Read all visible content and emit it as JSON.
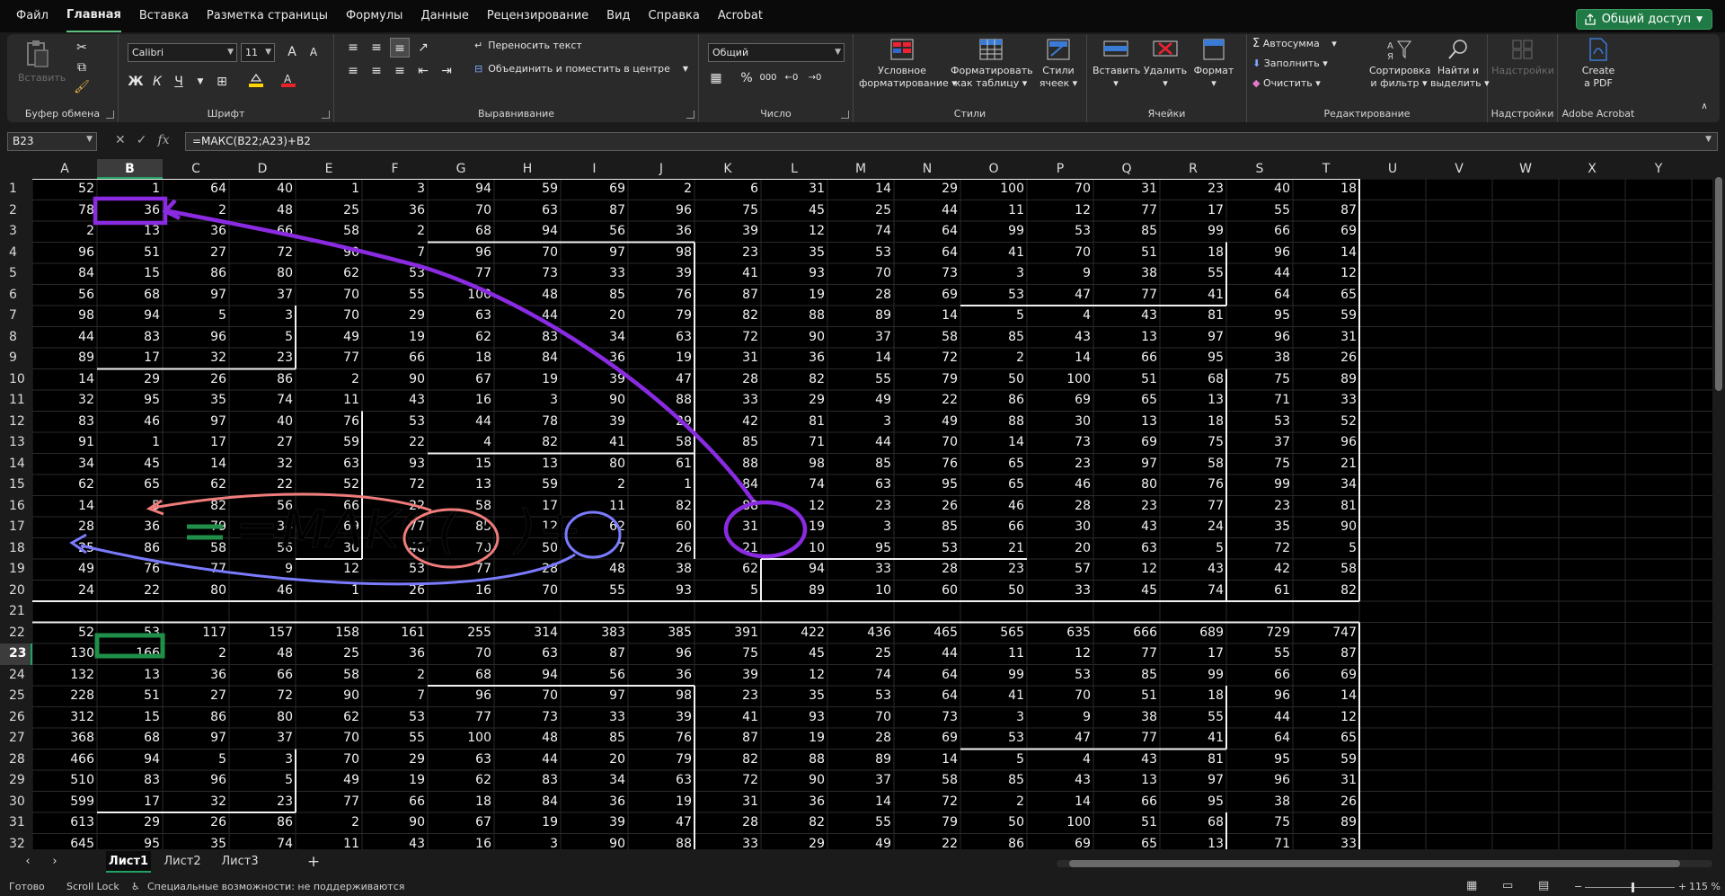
{
  "menu": {
    "items": [
      "Файл",
      "Главная",
      "Вставка",
      "Разметка страницы",
      "Формулы",
      "Данные",
      "Рецензирование",
      "Вид",
      "Справка",
      "Acrobat"
    ],
    "share": "Общий доступ"
  },
  "ribbon": {
    "clipboard": {
      "paste": "Вставить",
      "label": "Буфер обмена"
    },
    "font": {
      "name": "Calibri",
      "size": "11",
      "label": "Шрифт",
      "bold": "Ж",
      "italic": "К",
      "underline": "Ч"
    },
    "alignment": {
      "wrap": "Переносить текст",
      "merge": "Объединить и поместить в центре",
      "label": "Выравнивание"
    },
    "number": {
      "format": "Общий",
      "label": "Число",
      "percent": "%",
      "thousands": "000"
    },
    "styles": {
      "conditional": [
        "Условное",
        "форматирование"
      ],
      "table": [
        "Форматировать",
        "как таблицу"
      ],
      "cell": [
        "Стили",
        "ячеек"
      ],
      "label": "Стили"
    },
    "cells": {
      "insert": "Вставить",
      "delete": "Удалить",
      "format": "Формат",
      "label": "Ячейки"
    },
    "editing": {
      "autosum": "Автосумма",
      "fill": "Заполнить",
      "clear": "Очистить",
      "sort": [
        "Сортировка",
        "и фильтр"
      ],
      "find": [
        "Найти и",
        "выделить"
      ],
      "label": "Редактирование"
    },
    "addins": {
      "button": "Надстройки",
      "label": "Надстройки"
    },
    "acrobat": {
      "create": [
        "Create",
        "a PDF"
      ],
      "label": "Adobe Acrobat"
    }
  },
  "formula_bar": {
    "name_box": "B23",
    "fx": "fx",
    "formula": "=МАКС(B22;A23)+B2"
  },
  "columns": [
    "A",
    "B",
    "C",
    "D",
    "E",
    "F",
    "G",
    "H",
    "I",
    "J",
    "K",
    "L",
    "M",
    "N",
    "O",
    "P",
    "Q",
    "R",
    "S",
    "T",
    "U",
    "V",
    "W",
    "X",
    "Y"
  ],
  "rows": {
    "1": [
      52,
      1,
      64,
      40,
      1,
      3,
      94,
      59,
      69,
      2,
      6,
      31,
      14,
      29,
      100,
      70,
      31,
      23,
      40,
      18
    ],
    "2": [
      78,
      36,
      2,
      48,
      25,
      36,
      70,
      63,
      87,
      96,
      75,
      45,
      25,
      44,
      11,
      12,
      77,
      17,
      55,
      87
    ],
    "3": [
      2,
      13,
      36,
      66,
      58,
      2,
      68,
      94,
      56,
      36,
      39,
      12,
      74,
      64,
      99,
      53,
      85,
      99,
      66,
      69
    ],
    "4": [
      96,
      51,
      27,
      72,
      90,
      7,
      96,
      70,
      97,
      98,
      23,
      35,
      53,
      64,
      41,
      70,
      51,
      18,
      96,
      14
    ],
    "5": [
      84,
      15,
      86,
      80,
      62,
      53,
      77,
      73,
      33,
      39,
      41,
      93,
      70,
      73,
      3,
      9,
      38,
      55,
      44,
      12
    ],
    "6": [
      56,
      68,
      97,
      37,
      70,
      55,
      100,
      48,
      85,
      76,
      87,
      19,
      28,
      69,
      53,
      47,
      77,
      41,
      64,
      65
    ],
    "7": [
      98,
      94,
      5,
      3,
      70,
      29,
      63,
      44,
      20,
      79,
      82,
      88,
      89,
      14,
      5,
      4,
      43,
      81,
      95,
      59
    ],
    "8": [
      44,
      83,
      96,
      5,
      49,
      19,
      62,
      83,
      34,
      63,
      72,
      90,
      37,
      58,
      85,
      43,
      13,
      97,
      96,
      31
    ],
    "9": [
      89,
      17,
      32,
      23,
      77,
      66,
      18,
      84,
      36,
      19,
      31,
      36,
      14,
      72,
      2,
      14,
      66,
      95,
      38,
      26
    ],
    "10": [
      14,
      29,
      26,
      86,
      2,
      90,
      67,
      19,
      39,
      47,
      28,
      82,
      55,
      79,
      50,
      100,
      51,
      68,
      75,
      89
    ],
    "11": [
      32,
      95,
      35,
      74,
      11,
      43,
      16,
      3,
      90,
      88,
      33,
      29,
      49,
      22,
      86,
      69,
      65,
      13,
      71,
      33
    ],
    "12": [
      83,
      46,
      97,
      40,
      76,
      53,
      44,
      78,
      39,
      29,
      42,
      81,
      3,
      49,
      88,
      30,
      13,
      18,
      53,
      52
    ],
    "13": [
      91,
      1,
      17,
      27,
      59,
      22,
      4,
      82,
      41,
      58,
      85,
      71,
      44,
      70,
      14,
      73,
      69,
      75,
      37,
      96
    ],
    "14": [
      34,
      45,
      14,
      32,
      63,
      93,
      15,
      13,
      80,
      61,
      88,
      98,
      85,
      76,
      65,
      23,
      97,
      58,
      75,
      21
    ],
    "15": [
      62,
      65,
      62,
      22,
      52,
      72,
      13,
      59,
      2,
      1,
      84,
      74,
      63,
      95,
      65,
      46,
      80,
      76,
      99,
      34
    ],
    "16": [
      14,
      5,
      82,
      56,
      66,
      22,
      58,
      17,
      11,
      82,
      88,
      12,
      23,
      26,
      46,
      28,
      23,
      77,
      23,
      81
    ],
    "17": [
      28,
      36,
      79,
      34,
      69,
      77,
      85,
      12,
      62,
      60,
      31,
      19,
      3,
      85,
      66,
      30,
      43,
      24,
      35,
      90
    ],
    "18": [
      25,
      86,
      58,
      56,
      30,
      48,
      70,
      50,
      7,
      26,
      21,
      10,
      95,
      53,
      21,
      20,
      63,
      5,
      72,
      5
    ],
    "19": [
      49,
      76,
      77,
      9,
      12,
      53,
      77,
      28,
      48,
      38,
      62,
      94,
      33,
      28,
      23,
      57,
      12,
      43,
      42,
      58
    ],
    "20": [
      24,
      22,
      80,
      46,
      1,
      26,
      16,
      70,
      55,
      93,
      5,
      89,
      10,
      60,
      50,
      33,
      45,
      74,
      61,
      82
    ],
    "21": [],
    "22": [
      52,
      53,
      117,
      157,
      158,
      161,
      255,
      314,
      383,
      385,
      391,
      422,
      436,
      465,
      565,
      635,
      666,
      689,
      729,
      747
    ],
    "23": [
      130,
      166,
      2,
      48,
      25,
      36,
      70,
      63,
      87,
      96,
      75,
      45,
      25,
      44,
      11,
      12,
      77,
      17,
      55,
      87
    ],
    "24": [
      132,
      13,
      36,
      66,
      58,
      2,
      68,
      94,
      56,
      36,
      39,
      12,
      74,
      64,
      99,
      53,
      85,
      99,
      66,
      69
    ],
    "25": [
      228,
      51,
      27,
      72,
      90,
      7,
      96,
      70,
      97,
      98,
      23,
      35,
      53,
      64,
      41,
      70,
      51,
      18,
      96,
      14
    ],
    "26": [
      312,
      15,
      86,
      80,
      62,
      53,
      77,
      73,
      33,
      39,
      41,
      93,
      70,
      73,
      3,
      9,
      38,
      55,
      44,
      12
    ],
    "27": [
      368,
      68,
      97,
      37,
      70,
      55,
      100,
      48,
      85,
      76,
      87,
      19,
      28,
      69,
      53,
      47,
      77,
      41,
      64,
      65
    ],
    "28": [
      466,
      94,
      5,
      3,
      70,
      29,
      63,
      44,
      20,
      79,
      82,
      88,
      89,
      14,
      5,
      4,
      43,
      81,
      95,
      59
    ],
    "29": [
      510,
      83,
      96,
      5,
      49,
      19,
      62,
      83,
      34,
      63,
      72,
      90,
      37,
      58,
      85,
      43,
      13,
      97,
      96,
      31
    ],
    "30": [
      599,
      17,
      32,
      23,
      77,
      66,
      18,
      84,
      36,
      19,
      31,
      36,
      14,
      72,
      2,
      14,
      66,
      95,
      38,
      26
    ],
    "31": [
      613,
      29,
      26,
      86,
      2,
      90,
      67,
      19,
      39,
      47,
      28,
      82,
      55,
      79,
      50,
      100,
      51,
      68,
      75,
      89
    ],
    "32": [
      645,
      95,
      35,
      74,
      11,
      43,
      16,
      3,
      90,
      88,
      33,
      29,
      49,
      22,
      86,
      69,
      65,
      13,
      71,
      33
    ]
  },
  "annotation": {
    "text": "=MAKC(  ;  )+",
    "colors": {
      "purple": "#8a2be2",
      "red": "#f07c7c",
      "blue": "#7b7bff",
      "green": "#1f8f4a"
    }
  },
  "sheets": [
    "Лист1",
    "Лист2",
    "Лист3"
  ],
  "status": {
    "ready": "Готово",
    "scroll": "Scroll Lock",
    "accessibility": "Специальные возможности: не поддерживаются",
    "zoom": "115 %"
  }
}
